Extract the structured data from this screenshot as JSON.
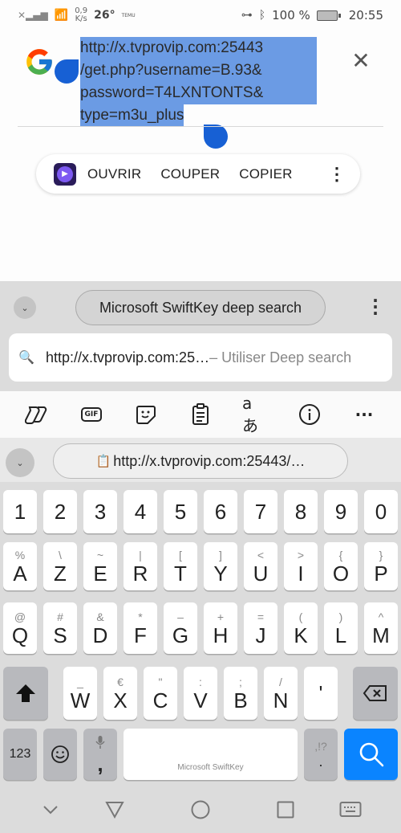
{
  "status_bar": {
    "network_speed_value": "0,9",
    "network_speed_unit": "K/s",
    "temperature": "26°",
    "temu_label": "TEMU",
    "battery": "100 %",
    "time": "20:55"
  },
  "search": {
    "url_lines": [
      "http://x.tvprovip.com:25443",
      "/get.php?username=B.93&",
      "password=T4LXNTONTS&",
      "type=m3u_plus"
    ],
    "selection_color": "#6b9be4",
    "handle_color": "#1760d4"
  },
  "context_menu": {
    "items": [
      "OUVRIR",
      "COUPER",
      "COPIER"
    ]
  },
  "keyboard": {
    "deep_search_label": "Microsoft SwiftKey deep search",
    "deep_search_url": "http://x.tvprovip.com:25…",
    "deep_search_hint": "– Utiliser Deep search",
    "clipboard_text": "http://x.tvprovip.com:25443/…",
    "gif_label": "GIF",
    "translate_label": "aあ",
    "rows": {
      "numbers": [
        "1",
        "2",
        "3",
        "4",
        "5",
        "6",
        "7",
        "8",
        "9",
        "0"
      ],
      "row1": [
        {
          "main": "A",
          "sec": "%"
        },
        {
          "main": "Z",
          "sec": "\\"
        },
        {
          "main": "E",
          "sec": "~"
        },
        {
          "main": "R",
          "sec": "|"
        },
        {
          "main": "T",
          "sec": "["
        },
        {
          "main": "Y",
          "sec": "]"
        },
        {
          "main": "U",
          "sec": "<"
        },
        {
          "main": "I",
          "sec": ">"
        },
        {
          "main": "O",
          "sec": "{"
        },
        {
          "main": "P",
          "sec": "}"
        }
      ],
      "row2": [
        {
          "main": "Q",
          "sec": "@"
        },
        {
          "main": "S",
          "sec": "#"
        },
        {
          "main": "D",
          "sec": "&"
        },
        {
          "main": "F",
          "sec": "*"
        },
        {
          "main": "G",
          "sec": "–"
        },
        {
          "main": "H",
          "sec": "+"
        },
        {
          "main": "J",
          "sec": "="
        },
        {
          "main": "K",
          "sec": "("
        },
        {
          "main": "L",
          "sec": ")"
        },
        {
          "main": "M",
          "sec": "^"
        }
      ],
      "row3": [
        {
          "main": "W",
          "sec": "_"
        },
        {
          "main": "X",
          "sec": "€"
        },
        {
          "main": "C",
          "sec": "\""
        },
        {
          "main": "V",
          "sec": ":"
        },
        {
          "main": "B",
          "sec": ";"
        },
        {
          "main": "N",
          "sec": "/"
        },
        {
          "main": "'",
          "sec": ""
        }
      ]
    },
    "num_switch_label": "123",
    "comma_label": ",",
    "period_label": ".",
    "punct_label": ",!?",
    "spacebar_label": "Microsoft SwiftKey",
    "search_key_color": "#0a84ff"
  }
}
